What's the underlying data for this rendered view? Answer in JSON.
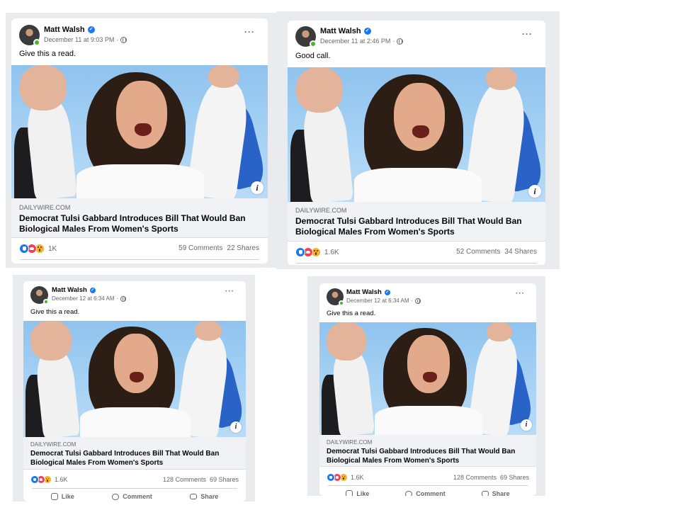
{
  "posts": [
    {
      "author": "Matt Walsh",
      "timestamp": "December 11 at 9:03 PM",
      "text": "Give this a read.",
      "link": {
        "domain": "DAILYWIRE.COM",
        "title": "Democrat Tulsi Gabbard Introduces Bill That Would Ban Biological Males From Women's Sports"
      },
      "reaction_count": "1K",
      "comments": "59 Comments",
      "shares": "22 Shares"
    },
    {
      "author": "Matt Walsh",
      "timestamp": "December 11 at 2:46 PM",
      "text": "Good call.",
      "link": {
        "domain": "DAILYWIRE.COM",
        "title": "Democrat Tulsi Gabbard Introduces Bill That Would Ban Biological Males From Women's Sports"
      },
      "reaction_count": "1.6K",
      "comments": "52 Comments",
      "shares": "34 Shares"
    },
    {
      "author": "Matt Walsh",
      "timestamp": "December 12 at 6:34 AM",
      "text": "Give this a read.",
      "link": {
        "domain": "DAILYWIRE.COM",
        "title": "Democrat Tulsi Gabbard Introduces Bill That Would Ban Biological Males From Women's Sports"
      },
      "reaction_count": "1.6K",
      "comments": "128 Comments",
      "shares": "69 Shares",
      "actions": {
        "like": "Like",
        "comment": "Comment",
        "share": "Share"
      }
    },
    {
      "author": "Matt Walsh",
      "timestamp": "December 12 at 6:34 AM",
      "text": "Give this a read.",
      "link": {
        "domain": "DAILYWIRE.COM",
        "title": "Democrat Tulsi Gabbard Introduces Bill That Would Ban Biological Males From Women's Sports"
      },
      "reaction_count": "1.6K",
      "comments": "128 Comments",
      "shares": "69 Shares",
      "actions": {
        "like": "Like",
        "comment": "Comment",
        "share": "Share"
      }
    }
  ],
  "icons": {
    "verified": "verified-badge-icon",
    "privacy": "globe-icon",
    "more": "more-options-icon",
    "info": "info-icon",
    "reactions": [
      "like-reaction-icon",
      "love-reaction-icon",
      "wow-reaction-icon"
    ]
  },
  "colors": {
    "accent": "#1877f2",
    "love": "#f33e58",
    "wow": "#f7b125",
    "online": "#42b72a",
    "backing": "#e9ebee"
  }
}
